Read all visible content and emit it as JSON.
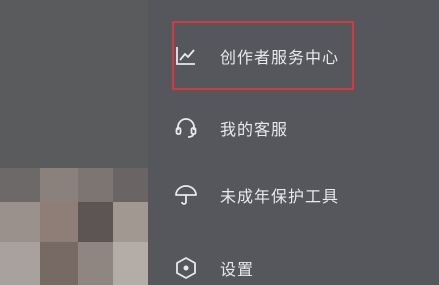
{
  "drawer": {
    "items": [
      {
        "label": "创作者服务中心",
        "icon": "chart-line-icon"
      },
      {
        "label": "我的客服",
        "icon": "headset-icon"
      },
      {
        "label": "未成年保护工具",
        "icon": "umbrella-icon"
      },
      {
        "label": "设置",
        "icon": "settings-hexagon-icon"
      }
    ]
  },
  "colors": {
    "drawer_bg": "#55575c",
    "text": "#e9e9eb",
    "highlight": "#d7383b"
  }
}
